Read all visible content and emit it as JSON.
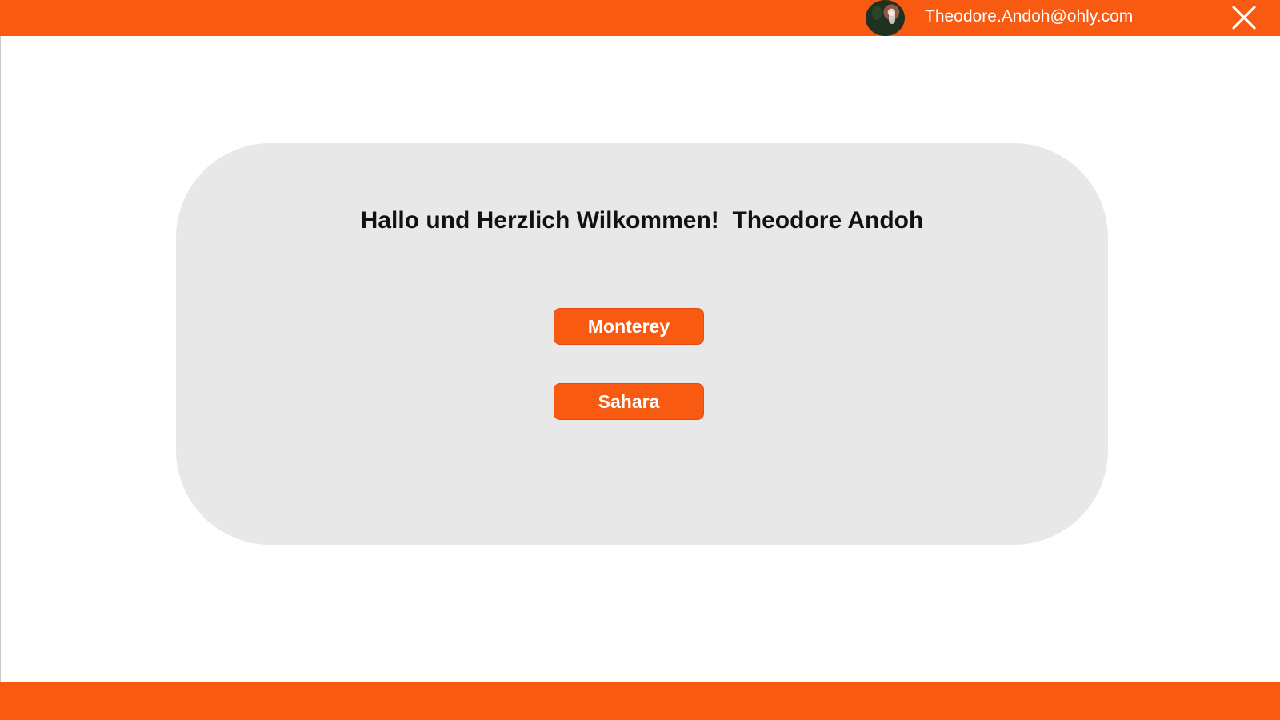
{
  "header": {
    "user_email": "Theodore.Andoh@ohly.com",
    "avatar_icon": "user-avatar",
    "close_icon": "close-icon",
    "background_color": "#f85a12"
  },
  "main": {
    "greeting": "Hallo und Herzlich Wilkommen!  Theodore Andoh",
    "buttons": [
      {
        "label": "Monterey"
      },
      {
        "label": "Sahara"
      }
    ],
    "card_color": "#e8e8e8",
    "button_color": "#f85a12"
  },
  "footer": {
    "background_color": "#f85a12"
  }
}
